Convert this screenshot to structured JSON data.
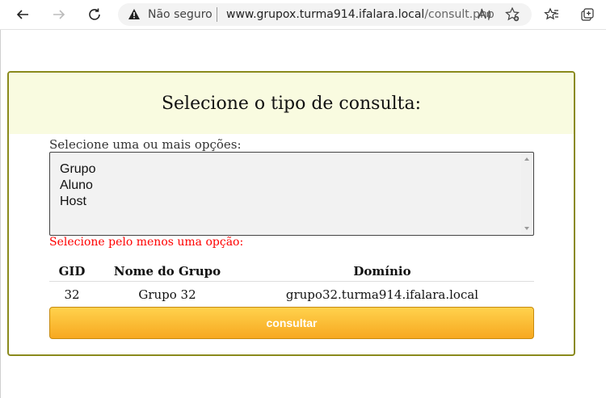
{
  "browser": {
    "security_label": "Não seguro",
    "url_host": "www.grupox.turma914.ifalara.local",
    "url_path": "/consult.php"
  },
  "page": {
    "title": "Selecione o tipo de consulta:",
    "prompt": "Selecione uma ou mais opções:",
    "options": [
      "Grupo",
      "Aluno",
      "Host"
    ],
    "error": "Selecione pelo menos uma opção:",
    "table": {
      "headers": [
        "GID",
        "Nome do Grupo",
        "Domínio"
      ],
      "rows": [
        [
          "32",
          "Grupo 32",
          "grupo32.turma914.ifalara.local"
        ]
      ]
    },
    "submit_label": "consultar"
  },
  "colors": {
    "header_bg": "#f9fbe0",
    "border": "#8a8a1c",
    "error": "#ff0000",
    "button": "#f7a820"
  }
}
